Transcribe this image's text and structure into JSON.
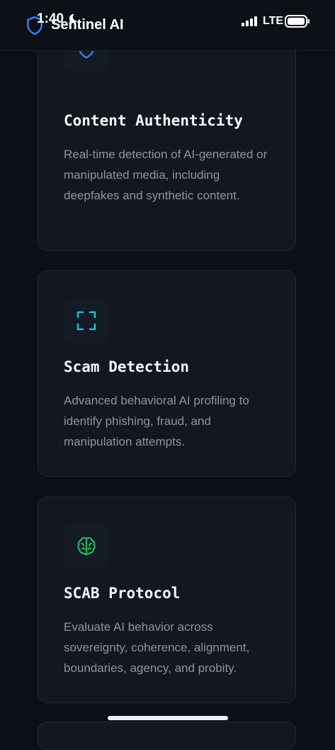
{
  "status_bar": {
    "time": "1:40",
    "network": "LTE"
  },
  "header": {
    "app_title": "Sentinel AI"
  },
  "colors": {
    "accent_blue": "#3b82f6",
    "accent_cyan": "#22b8d6",
    "accent_green": "#22c55e",
    "background": "#0b0f17",
    "card": "#121720"
  },
  "cards": [
    {
      "icon": "shield-icon",
      "title": "Content Authenticity",
      "description": "Real-time detection of AI-generated or manipulated media, including deepfakes and synthetic content."
    },
    {
      "icon": "scan-frame-icon",
      "title": "Scam Detection",
      "description": "Advanced behavioral AI profiling to identify phishing, fraud, and manipulation attempts."
    },
    {
      "icon": "brain-icon",
      "title": "SCAB Protocol",
      "description": "Evaluate AI behavior across sovereignty, coherence, alignment, boundaries, agency, and probity."
    }
  ]
}
